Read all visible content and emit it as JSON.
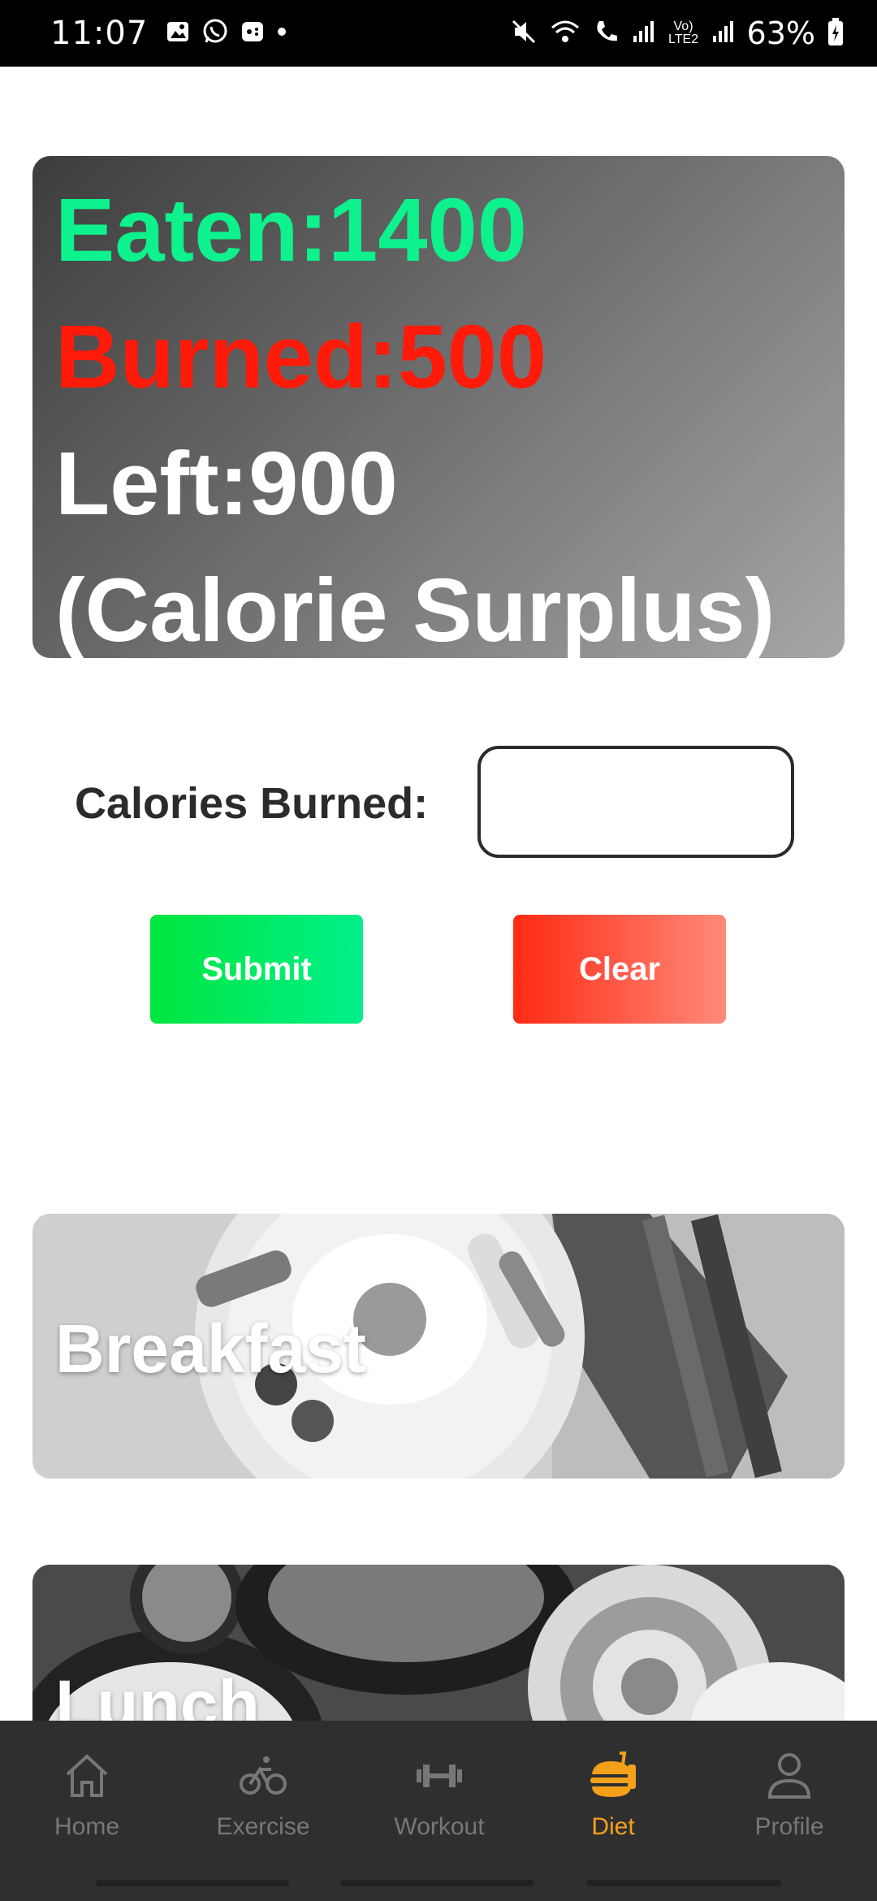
{
  "status_bar": {
    "time": "11:07",
    "battery": "63%",
    "network_label": "Vo) LTE2"
  },
  "summary": {
    "eaten": "Eaten:1400",
    "burned": "Burned:500",
    "left": "Left:900",
    "status": "(Calorie Surplus)",
    "colors": {
      "eaten": "#0df28c",
      "burned": "#ff1a0a",
      "left": "#ffffff"
    }
  },
  "calories_form": {
    "label": "Calories Burned:",
    "value": "",
    "placeholder": "",
    "submit_label": "Submit",
    "clear_label": "Clear"
  },
  "meals": [
    {
      "title": "Breakfast",
      "image_icon": "breakfast-photo"
    },
    {
      "title": "Lunch",
      "image_icon": "lunch-photo"
    }
  ],
  "bottom_nav": {
    "items": [
      {
        "label": "Home",
        "icon": "home-icon",
        "active": false
      },
      {
        "label": "Exercise",
        "icon": "bicycle-icon",
        "active": false
      },
      {
        "label": "Workout",
        "icon": "dumbbell-icon",
        "active": false
      },
      {
        "label": "Diet",
        "icon": "burger-icon",
        "active": true
      },
      {
        "label": "Profile",
        "icon": "person-icon",
        "active": false
      }
    ],
    "active_color": "#f5a01a",
    "inactive_color": "#777777"
  }
}
